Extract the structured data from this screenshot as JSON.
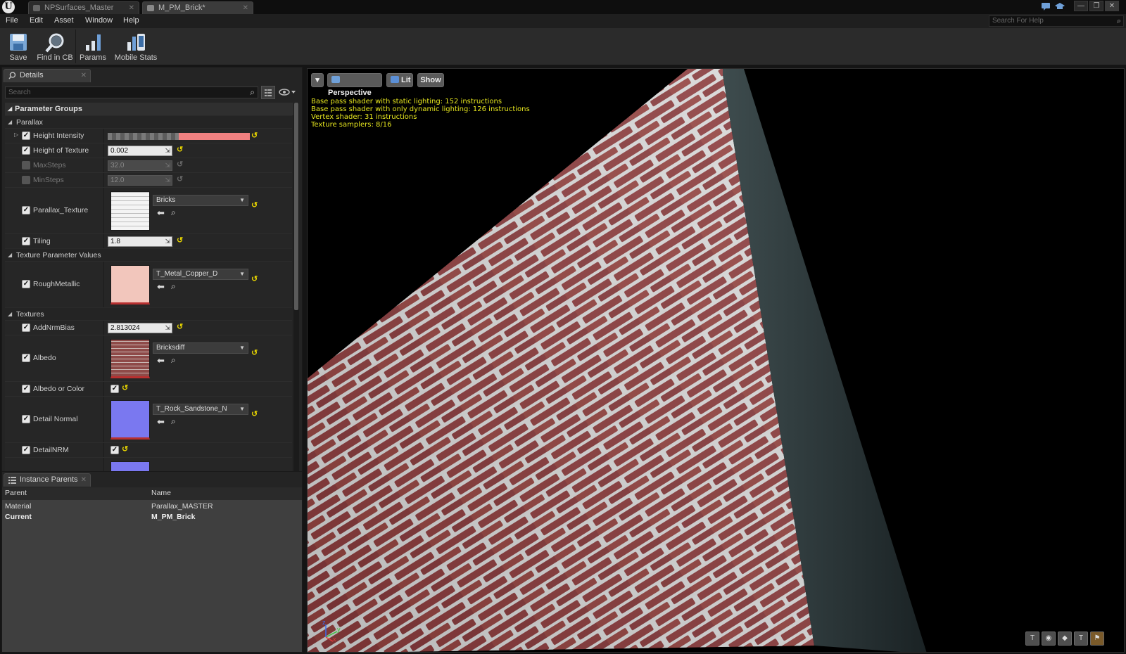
{
  "window": {
    "logo": "U",
    "tabs": [
      {
        "label": "NPSurfaces_Master",
        "active": false
      },
      {
        "label": "M_PM_Brick*",
        "active": true
      }
    ],
    "buttons": {
      "minimize": "—",
      "restore": "❐",
      "close": "✕"
    }
  },
  "menu": {
    "items": [
      "File",
      "Edit",
      "Asset",
      "Window",
      "Help"
    ],
    "help_search_placeholder": "Search For Help"
  },
  "toolbar": {
    "buttons": [
      {
        "label": "Save",
        "icon": "save-icon"
      },
      {
        "label": "Find in CB",
        "icon": "magnifier-icon"
      },
      {
        "label": "Params",
        "icon": "bar-chart-icon"
      },
      {
        "label": "Mobile Stats",
        "icon": "mobile-stats-icon"
      }
    ]
  },
  "details": {
    "tab_label": "Details",
    "search_placeholder": "Search",
    "header": "Parameter Groups",
    "groups": {
      "parallax": "Parallax",
      "texture_param_values": "Texture Parameter Values",
      "textures": "Textures"
    },
    "props": {
      "height_intensity": {
        "label": "Height Intensity",
        "enabled": true,
        "checker_fraction": 0.5
      },
      "height_of_texture": {
        "label": "Height of Texture",
        "value": "0.002",
        "enabled": true
      },
      "max_steps": {
        "label": "MaxSteps",
        "value": "32.0",
        "enabled": false
      },
      "min_steps": {
        "label": "MinSteps",
        "value": "12.0",
        "enabled": false
      },
      "parallax_texture": {
        "label": "Parallax_Texture",
        "asset": "Bricks",
        "enabled": true
      },
      "tiling": {
        "label": "Tiling",
        "value": "1.8",
        "enabled": true
      },
      "rough_metallic": {
        "label": "RoughMetallic",
        "asset": "T_Metal_Copper_D",
        "enabled": true
      },
      "add_nrm_bias": {
        "label": "AddNrmBias",
        "value": "2.813024",
        "enabled": true
      },
      "albedo": {
        "label": "Albedo",
        "asset": "Bricksdiff",
        "enabled": true
      },
      "albedo_or_color": {
        "label": "Albedo or Color",
        "enabled": true,
        "checked": true
      },
      "detail_normal": {
        "label": "Detail Normal",
        "asset": "T_Rock_Sandstone_N",
        "enabled": true
      },
      "detail_nrm": {
        "label": "DetailNRM",
        "enabled": true,
        "checked": true
      }
    }
  },
  "instance_parents": {
    "tab_label": "Instance Parents",
    "columns": [
      "Parent",
      "Name"
    ],
    "rows": [
      {
        "parent": "Material",
        "name": "Parallax_MASTER",
        "bold": false
      },
      {
        "parent": "Current",
        "name": "M_PM_Brick",
        "bold": true
      }
    ]
  },
  "viewport": {
    "buttons": {
      "menu": "▾",
      "perspective": "Perspective",
      "lit": "Lit",
      "show": "Show"
    },
    "stats": [
      "Base pass shader with static lighting: 152 instructions",
      "Base pass shader with only dynamic lighting: 126 instructions",
      "Vertex shader: 31 instructions",
      "Texture samplers: 8/16"
    ],
    "axis_labels": {
      "x": "x",
      "y": "y",
      "z": "z"
    },
    "corner_buttons": [
      "T",
      "◉",
      "◆",
      "T",
      "⚑"
    ]
  },
  "colors": {
    "stats_text": "#e6e61e",
    "reset_arrow": "#e7d400",
    "height_intensity_fill": "#f08080",
    "brick": "#8f3d3d",
    "mortar": "#d8d8d8"
  }
}
